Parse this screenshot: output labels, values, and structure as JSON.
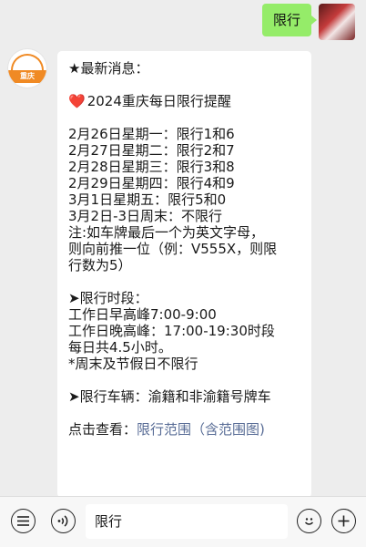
{
  "user_message": {
    "text": "限行"
  },
  "bot_avatar": {
    "brand_label": "重庆"
  },
  "message": {
    "header": "★最新消息：",
    "headline": "2024重庆每日限行提醒",
    "schedule": [
      "2月26日星期一：限行1和6",
      "2月27日星期二：限行2和7",
      "2月28日星期三：限行3和8",
      "2月29日星期四：限行4和9",
      "3月1日星期五：限行5和0",
      "3月2日-3日周末：不限行"
    ],
    "note_lines": [
      "注:如车牌最后一个为英文字母，",
      "则向前推一位（例：V555X，则限",
      "行数为5）"
    ],
    "period_title": "➤限行时段：",
    "period_lines": [
      "工作日早高峰7:00-9:00",
      "工作日晚高峰：17:00-19:30时段",
      "每日共4.5小时。",
      "*周末及节假日不限行"
    ],
    "vehicles": "➤限行车辆：渝籍和非渝籍号牌车",
    "link_prefix": "点击查看：",
    "link_text": "限行范围（含范围图)"
  },
  "input_bar": {
    "value": "限行",
    "icons": [
      "list-icon",
      "voice-icon",
      "emoji-icon",
      "plus-icon"
    ]
  },
  "colors": {
    "user_bubble": "#95ec69",
    "background": "#ededed",
    "link": "#576b95",
    "heart": "#e0302f",
    "brand_orange": "#f08a24"
  }
}
